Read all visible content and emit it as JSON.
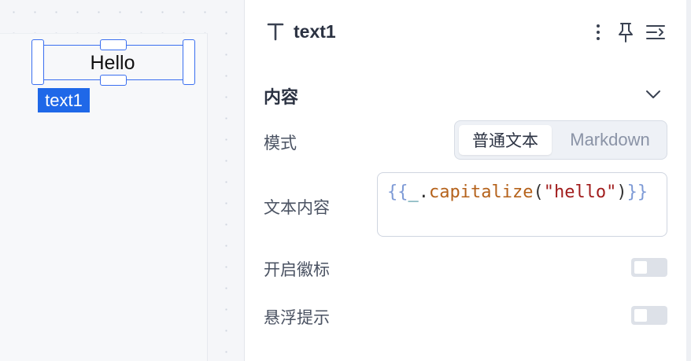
{
  "canvas": {
    "component_text": "Hello",
    "component_tag": "text1"
  },
  "panel": {
    "header": {
      "type_icon": "text-type-icon",
      "component_name": "text1"
    },
    "section": {
      "title": "内容",
      "collapse_icon": "chevron-down-icon"
    },
    "fields": {
      "mode": {
        "label": "模式",
        "options": [
          "普通文本",
          "Markdown"
        ],
        "selected": "普通文本"
      },
      "content": {
        "label": "文本内容",
        "tokens": [
          {
            "t": "{{",
            "c": "c-brace"
          },
          {
            "t": "_",
            "c": "c-under"
          },
          {
            "t": ".",
            "c": "c-dot"
          },
          {
            "t": "capitalize",
            "c": "c-fn"
          },
          {
            "t": "(",
            "c": "c-paren"
          },
          {
            "t": "\"hello\"",
            "c": "c-str"
          },
          {
            "t": ")",
            "c": "c-paren"
          },
          {
            "t": "}}",
            "c": "c-brace"
          }
        ]
      },
      "badge": {
        "label": "开启徽标",
        "enabled": false
      },
      "tooltip": {
        "label": "悬浮提示",
        "enabled": false
      }
    }
  },
  "colors": {
    "accent": "#1f68e8",
    "selection": "#3a6ff0"
  }
}
